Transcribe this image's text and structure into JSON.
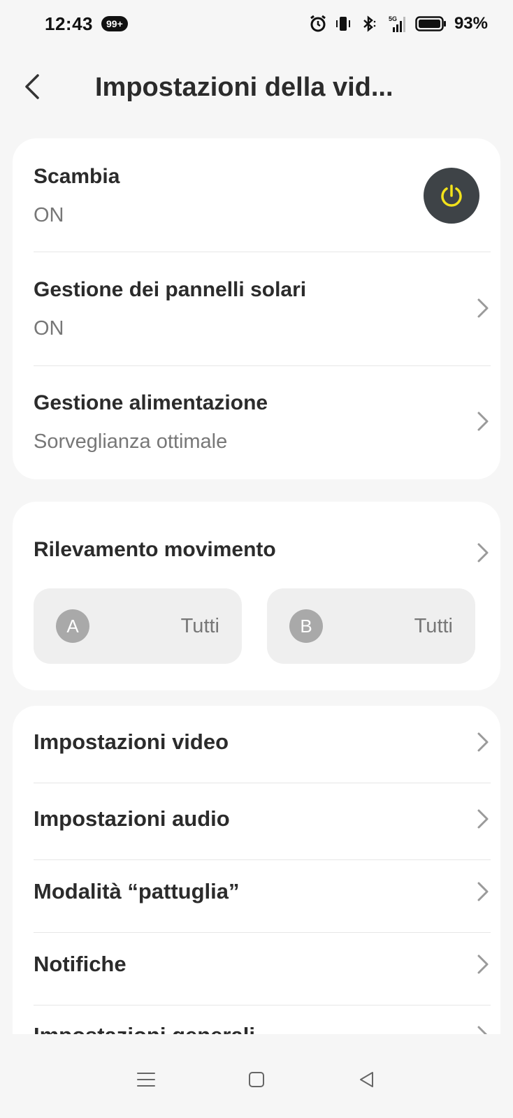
{
  "status_bar": {
    "time": "12:43",
    "badge": "99+",
    "battery": "93%",
    "network": "5G"
  },
  "header": {
    "title": "Impostazioni della vid..."
  },
  "card_power": {
    "rows": [
      {
        "title": "Scambia",
        "value": "ON"
      },
      {
        "title": "Gestione dei pannelli solari",
        "value": "ON"
      },
      {
        "title": "Gestione alimentazione",
        "value": "Sorveglianza ottimale"
      }
    ]
  },
  "card_motion": {
    "title": "Rilevamento movimento",
    "zones": [
      {
        "letter": "A",
        "value": "Tutti"
      },
      {
        "letter": "B",
        "value": "Tutti"
      }
    ]
  },
  "card_settings": {
    "items": [
      "Impostazioni video",
      "Impostazioni audio",
      "Modalità “pattuglia”",
      "Notifiche",
      "Impostazioni generali"
    ]
  },
  "colors": {
    "background": "#f6f6f6",
    "card": "#ffffff",
    "power_button": "#3e4347",
    "power_icon": "#f2e21b",
    "secondary_text": "#777777"
  }
}
